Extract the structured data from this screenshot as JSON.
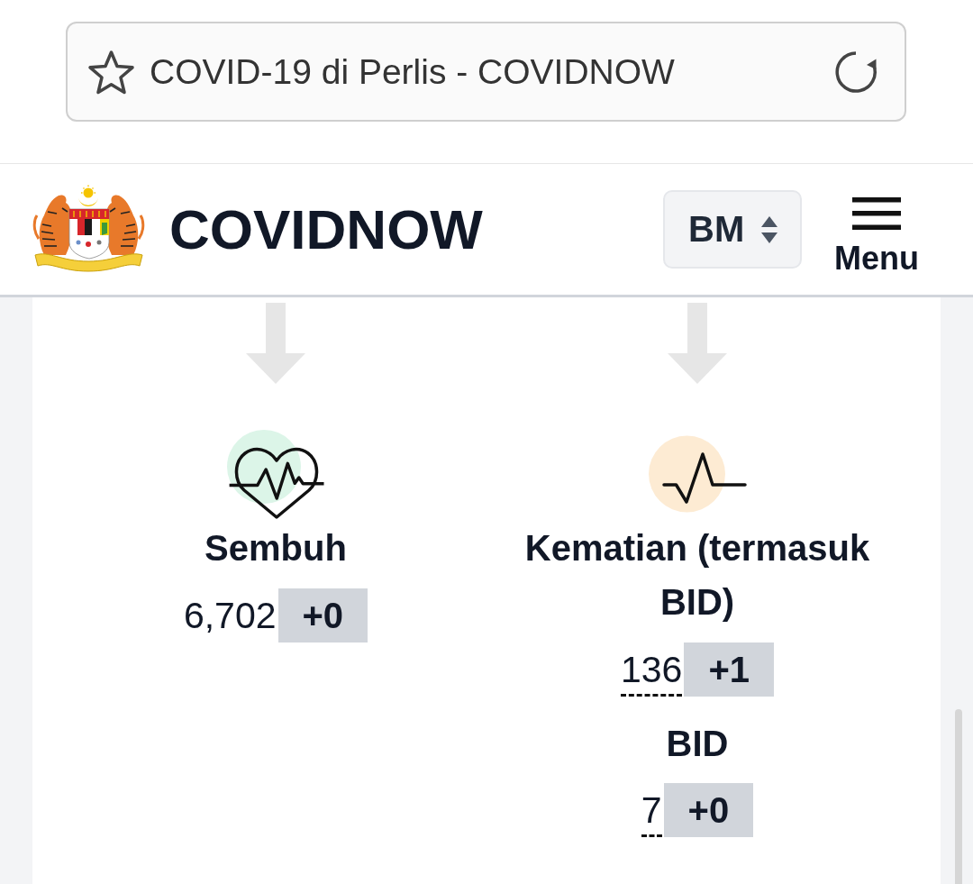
{
  "browser": {
    "page_title": "COVID-19 di Perlis - COVIDNOW"
  },
  "header": {
    "site_name": "COVIDNOW",
    "language": "BM",
    "menu_label": "Menu"
  },
  "stats": [
    {
      "label": "Sembuh",
      "color": "#dcf5e8",
      "value": "6,702",
      "underlined": false,
      "change": "+0"
    },
    {
      "label": "Kematian (termasuk BID)",
      "color": "#fdebd3",
      "value": "136",
      "underlined": true,
      "change": "+1",
      "breakdown": {
        "label": "BID",
        "value": "7",
        "underlined": true,
        "change": "+0"
      }
    }
  ]
}
